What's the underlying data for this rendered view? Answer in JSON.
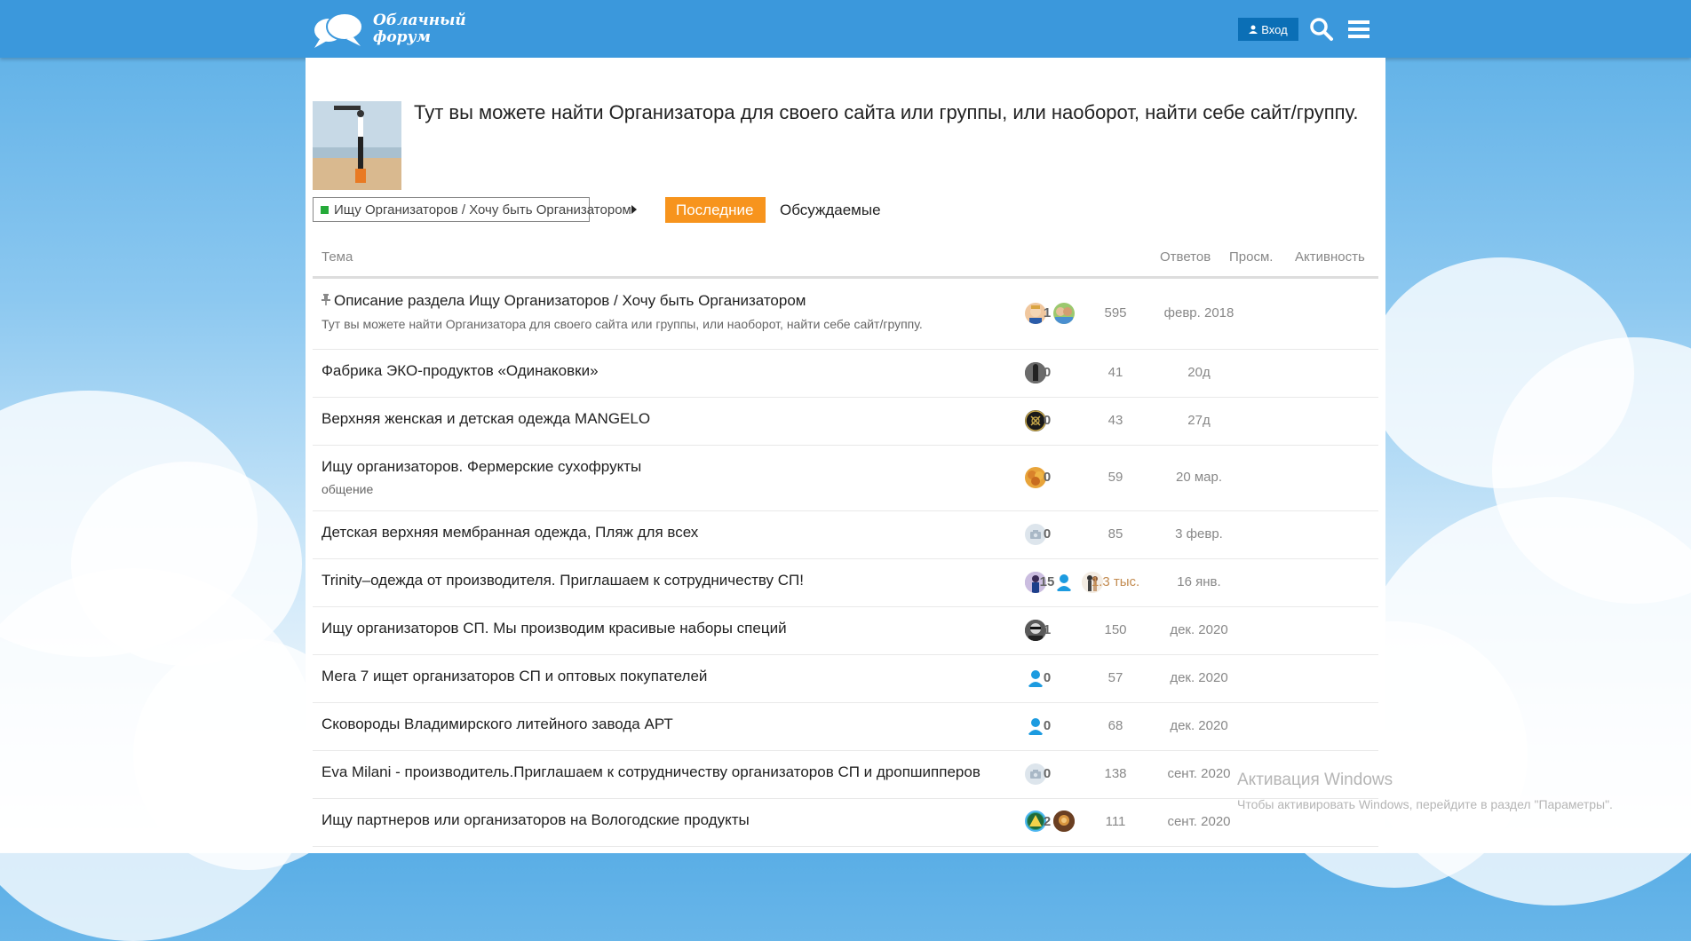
{
  "header": {
    "logo_line1": "Облачный",
    "logo_line2": "форум",
    "login_label": "Вход"
  },
  "category": {
    "description": "Тут вы можете найти Организатора для своего сайта или группы, или наоборот, найти себе сайт/группу.",
    "breadcrumb_label": "Ищу Организаторов / Хочу быть Организатором",
    "breadcrumb_color": "#25aa39"
  },
  "nav": {
    "latest": "Последние",
    "top": "Обсуждаемые"
  },
  "table": {
    "headers": {
      "topic": "Тема",
      "replies": "Ответов",
      "views": "Просм.",
      "activity": "Активность"
    },
    "rows": [
      {
        "title": "Описание раздела Ищу Организаторов / Хочу быть Организатором",
        "excerpt": "Тут вы можете найти Организатора для своего сайта или группы, или наоборот, найти себе сайт/группу.",
        "pinned": true,
        "replies": "1",
        "views": "595",
        "activity": "февр. 2018",
        "avatars": [
          "user-avatar-1",
          "user-avatar-2"
        ]
      },
      {
        "title": "Фабрика ЭКО-продуктов «Одинаковки»",
        "replies": "0",
        "views": "41",
        "activity": "20д",
        "avatars": [
          "user-avatar-3"
        ]
      },
      {
        "title": "Верхняя женская и детская одежда MANGELO",
        "replies": "0",
        "views": "43",
        "activity": "27д",
        "avatars": [
          "user-avatar-4"
        ]
      },
      {
        "title": "Ищу организаторов. Фермерские сухофрукты",
        "excerpt": "общение",
        "replies": "0",
        "views": "59",
        "activity": "20 мар.",
        "avatars": [
          "user-avatar-5"
        ]
      },
      {
        "title": "Детская верхняя мембранная одежда, Пляж для всех",
        "replies": "0",
        "views": "85",
        "activity": "3 февр.",
        "avatars": [
          "camera-avatar"
        ]
      },
      {
        "title": "Trinity–одежда от производителя. Приглашаем к сотрудничеству СП!",
        "replies": "15",
        "views": "1.3 тыс.",
        "views_hot": true,
        "activity": "16 янв.",
        "avatars": [
          "user-avatar-6",
          "default-avatar",
          "user-avatar-7"
        ]
      },
      {
        "title": "Ищу организаторов СП. Мы производим красивые наборы специй",
        "replies": "1",
        "views": "150",
        "activity": "дек. 2020",
        "avatars": [
          "user-avatar-8"
        ]
      },
      {
        "title": "Мега 7 ищет организаторов СП и оптовых покупателей",
        "replies": "0",
        "views": "57",
        "activity": "дек. 2020",
        "avatars": [
          "default-avatar"
        ]
      },
      {
        "title": "Сковороды Владимирского литейного завода АРТ",
        "replies": "0",
        "views": "68",
        "activity": "дек. 2020",
        "avatars": [
          "default-avatar"
        ]
      },
      {
        "title": "Eva Milani - производитель.Приглашаем к сотрудничеству организаторов СП и дропшипперов",
        "replies": "0",
        "views": "138",
        "activity": "сент. 2020",
        "avatars": [
          "camera-avatar"
        ]
      },
      {
        "title": "Ищу партнеров или организаторов на Вологодские продукты",
        "replies": "2",
        "views": "111",
        "activity": "сент. 2020",
        "avatars": [
          "user-avatar-9",
          "user-avatar-10"
        ]
      }
    ]
  },
  "watermark": {
    "line1": "Активация Windows",
    "line2": "Чтобы активировать Windows, перейдите в раздел \"Параметры\"."
  },
  "colors": {
    "header": "#3b98dc",
    "accent": "#f7941d",
    "hot_views": "#c38b50"
  }
}
